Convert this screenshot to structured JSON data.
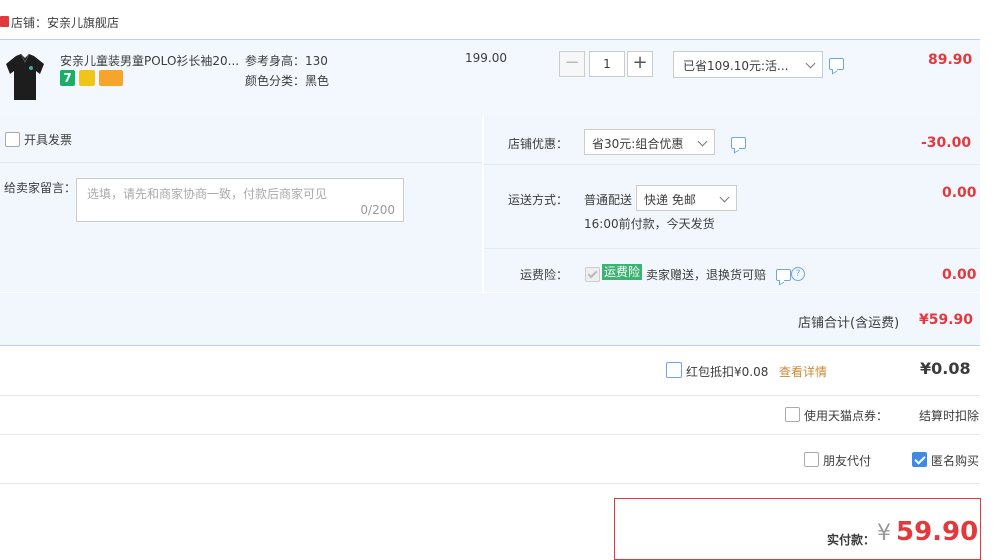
{
  "store": {
    "label": "店铺：安亲儿旗舰店"
  },
  "item": {
    "title": "安亲儿童装男童POLO衫长袖20...",
    "badge_7": "7",
    "sku_height": "参考身高：130",
    "sku_color": "颜色分类：黑色",
    "unit_price": "199.00",
    "quantity": "1",
    "minus": "−",
    "plus": "+",
    "promo": "已省109.10元:活...",
    "total": "89.90"
  },
  "options": {
    "invoice_label": "开具发票",
    "message_label": "给卖家留言：",
    "message_placeholder": "选填，请先和商家协商一致，付款后商家可见",
    "message_count": "0/200",
    "shop_discount_label": "店铺优惠：",
    "shop_discount_value": "省30元:组合优惠",
    "shop_discount_amount": "-30.00",
    "shipping_label": "运送方式：",
    "shipping_type": "普通配送",
    "shipping_select": "快递 免邮",
    "shipping_note": "16:00前付款，今天发货",
    "shipping_amount": "0.00",
    "freight_ins_label": "运费险：",
    "freight_ins_badge": "运费险",
    "freight_ins_text": "卖家赠送，退换货可赔",
    "freight_ins_amount": "0.00",
    "help_glyph": "?"
  },
  "store_total": {
    "label": "店铺合计(含运费)",
    "amount": "¥59.90"
  },
  "redpacket": {
    "label": "红包抵扣¥0.08",
    "link": "查看详情",
    "amount": "¥0.08"
  },
  "tmall_points": {
    "label": "使用天猫点券：",
    "note": "结算时扣除"
  },
  "payment_options": {
    "friend_pay": "朋友代付",
    "anonymous": "匿名购买"
  },
  "pay": {
    "label": "实付款：",
    "currency": "¥",
    "amount": "59.90"
  },
  "colors": {
    "accent_red": "#e4393c",
    "light_blue_bg": "#f2f7fe",
    "checkbox_blue": "#3f8be6",
    "badge_green": "#3cb371"
  }
}
